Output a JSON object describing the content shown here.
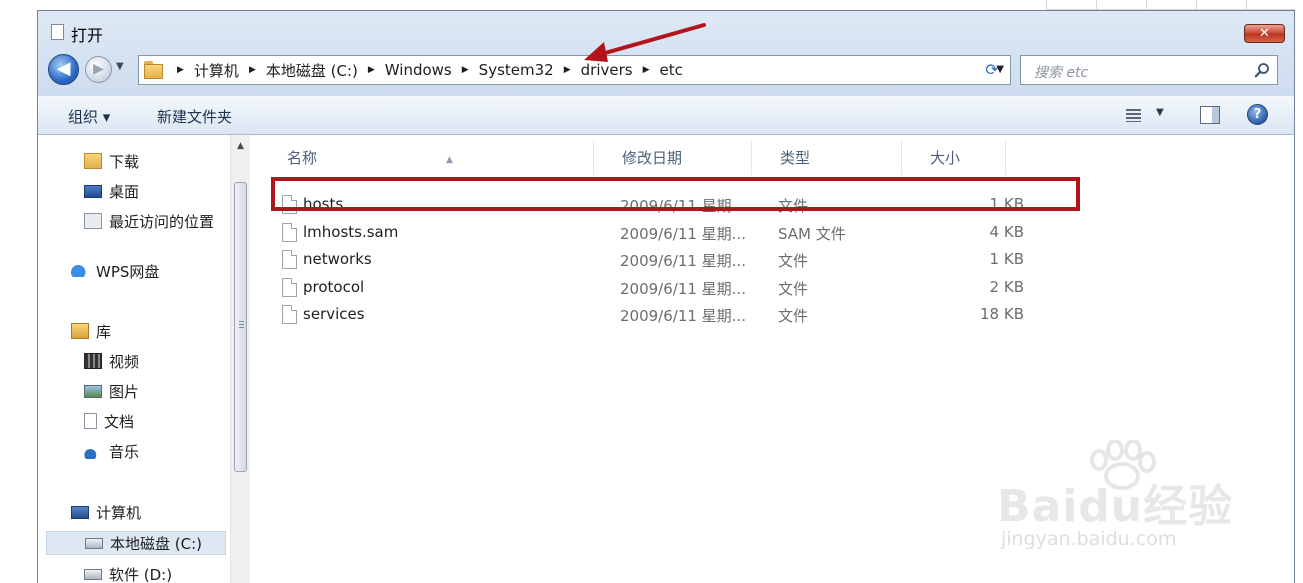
{
  "window": {
    "title": "打开",
    "close_label": "✕"
  },
  "address": {
    "crumbs": [
      "计算机",
      "本地磁盘 (C:)",
      "Windows",
      "System32",
      "drivers",
      "etc"
    ]
  },
  "search": {
    "placeholder": "搜索 etc"
  },
  "toolbar": {
    "organize_label": "组织 ▾",
    "new_folder_label": "新建文件夹"
  },
  "nav": {
    "items": [
      {
        "label": "下载",
        "icon": "download-folder-icon"
      },
      {
        "label": "桌面",
        "icon": "desktop-icon"
      },
      {
        "label": "最近访问的位置",
        "icon": "recent-places-icon"
      },
      {
        "label": "WPS网盘",
        "icon": "cloud-icon"
      },
      {
        "label": "库",
        "icon": "library-icon"
      },
      {
        "label": "视频",
        "icon": "video-icon"
      },
      {
        "label": "图片",
        "icon": "picture-icon"
      },
      {
        "label": "文档",
        "icon": "document-icon"
      },
      {
        "label": "音乐",
        "icon": "music-icon"
      },
      {
        "label": "计算机",
        "icon": "computer-icon"
      },
      {
        "label": "本地磁盘 (C:)",
        "icon": "drive-icon",
        "selected": true
      },
      {
        "label": "软件 (D:)",
        "icon": "drive-icon"
      }
    ]
  },
  "files": {
    "columns": [
      "名称",
      "修改日期",
      "类型",
      "大小"
    ],
    "rows": [
      {
        "name": "hosts",
        "date": "2009/6/11 星期...",
        "type": "文件",
        "size": "1 KB"
      },
      {
        "name": "lmhosts.sam",
        "date": "2009/6/11 星期...",
        "type": "SAM 文件",
        "size": "4 KB"
      },
      {
        "name": "networks",
        "date": "2009/6/11 星期...",
        "type": "文件",
        "size": "1 KB"
      },
      {
        "name": "protocol",
        "date": "2009/6/11 星期...",
        "type": "文件",
        "size": "2 KB"
      },
      {
        "name": "services",
        "date": "2009/6/11 星期...",
        "type": "文件",
        "size": "18 KB"
      }
    ]
  },
  "watermark": {
    "brand": "Baidu经验",
    "url": "jingyan.baidu.com"
  },
  "colors": {
    "highlight": "#b0151c",
    "arrow": "#b3141c",
    "accent": "#2d6ac5"
  }
}
